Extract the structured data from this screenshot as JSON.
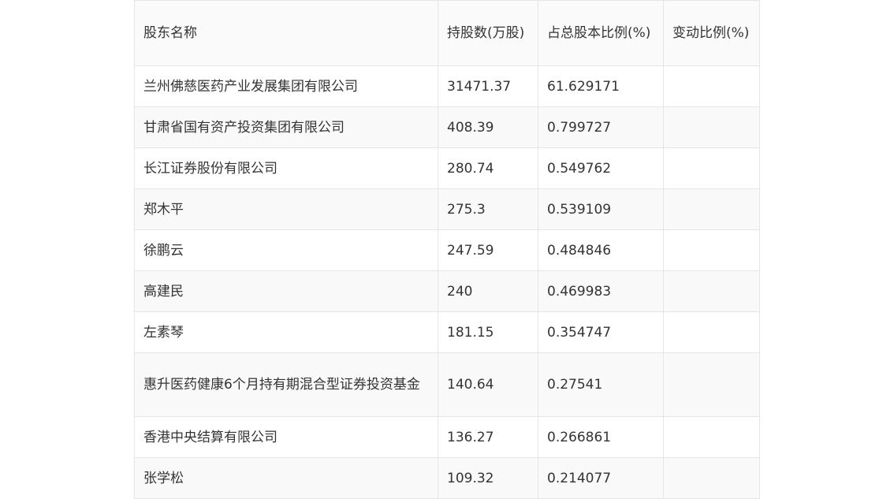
{
  "table": {
    "headers": [
      "股东名称",
      "持股数(万股)",
      "占总股本比例(%)",
      "变动比例(%)"
    ],
    "rows": [
      {
        "name": "兰州佛慈医药产业发展集团有限公司",
        "shares": "31471.37",
        "ratio": "61.629171",
        "change": ""
      },
      {
        "name": "甘肃省国有资产投资集团有限公司",
        "shares": "408.39",
        "ratio": "0.799727",
        "change": ""
      },
      {
        "name": "长江证券股份有限公司",
        "shares": "280.74",
        "ratio": "0.549762",
        "change": ""
      },
      {
        "name": "郑木平",
        "shares": "275.3",
        "ratio": "0.539109",
        "change": ""
      },
      {
        "name": "徐鹏云",
        "shares": "247.59",
        "ratio": "0.484846",
        "change": ""
      },
      {
        "name": "高建民",
        "shares": "240",
        "ratio": "0.469983",
        "change": ""
      },
      {
        "name": "左素琴",
        "shares": "181.15",
        "ratio": "0.354747",
        "change": ""
      },
      {
        "name": "惠升医药健康6个月持有期混合型证券投资基金",
        "shares": "140.64",
        "ratio": "0.27541",
        "change": ""
      },
      {
        "name": "香港中央结算有限公司",
        "shares": "136.27",
        "ratio": "0.266861",
        "change": ""
      },
      {
        "name": "张学松",
        "shares": "109.32",
        "ratio": "0.214077",
        "change": ""
      }
    ]
  }
}
